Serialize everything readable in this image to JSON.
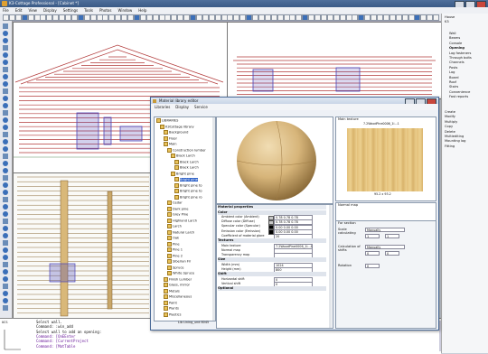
{
  "window": {
    "title": "K3-Cottage Professional - [Cabinet *]"
  },
  "menu": [
    "File",
    "Edit",
    "View",
    "Display",
    "Settings",
    "Tools",
    "Photos",
    "Window",
    "Help"
  ],
  "right_panel": {
    "top_items": [
      "House",
      "K3"
    ],
    "items": [
      {
        "label": "Wall"
      },
      {
        "label": "Beams"
      },
      {
        "label": "Console"
      },
      {
        "label": "Opening"
      },
      {
        "label": "Log fasteners"
      },
      {
        "label": "Through bolts"
      },
      {
        "label": "Channels"
      },
      {
        "label": "Posts"
      },
      {
        "label": "Log"
      },
      {
        "label": "Board"
      },
      {
        "label": "Roof"
      },
      {
        "label": "Stairs"
      },
      {
        "label": "Convenience"
      },
      {
        "label": "Fast reports"
      }
    ],
    "items2": [
      {
        "label": "Create"
      },
      {
        "label": "Modify"
      },
      {
        "label": "Multiply"
      },
      {
        "label": "Copy"
      },
      {
        "label": "Delete"
      },
      {
        "label": "Multiediting"
      },
      {
        "label": "Mounting log"
      },
      {
        "label": "Fitting"
      }
    ]
  },
  "command_area": {
    "side_label": "UCS",
    "lines": [
      "Select wall.",
      "Command: :win_add",
      "Select wall to add an opening:",
      "Command: [OnEEnter",
      "Command: [CurrentProject",
      "Command: [MatTable"
    ]
  },
  "dialog": {
    "title": "Material library editor",
    "menu": [
      "Libraries",
      "Display",
      "Service"
    ],
    "tree": [
      {
        "label": "LIBRARIES",
        "indent": 0
      },
      {
        "label": "K3Cottage library",
        "indent": 1
      },
      {
        "label": "Background",
        "indent": 2
      },
      {
        "label": "Floor",
        "indent": 2
      },
      {
        "label": "Main",
        "indent": 2
      },
      {
        "label": "Construction lumber",
        "indent": 3
      },
      {
        "label": "Black Larch",
        "indent": 4
      },
      {
        "label": "Black Larch",
        "indent": 5
      },
      {
        "label": "Black Larch",
        "indent": 5
      },
      {
        "label": "Bright pine",
        "indent": 4
      },
      {
        "label": "Bright pine",
        "indent": 5,
        "selected": true
      },
      {
        "label": "Bright pine to",
        "indent": 5
      },
      {
        "label": "Bright pine to",
        "indent": 5
      },
      {
        "label": "Bright pine ro",
        "indent": 5
      },
      {
        "label": "Cedar",
        "indent": 3
      },
      {
        "label": "Dark pine",
        "indent": 3
      },
      {
        "label": "Grey Pine",
        "indent": 3
      },
      {
        "label": "Highland Larch",
        "indent": 3
      },
      {
        "label": "Larch",
        "indent": 3
      },
      {
        "label": "Natural Larch",
        "indent": 3
      },
      {
        "label": "Oak",
        "indent": 3
      },
      {
        "label": "Pine",
        "indent": 3
      },
      {
        "label": "Pine 1",
        "indent": 3
      },
      {
        "label": "Pine 2",
        "indent": 3
      },
      {
        "label": "Siberian Fir",
        "indent": 3
      },
      {
        "label": "Spruce",
        "indent": 3
      },
      {
        "label": "White Spruce",
        "indent": 3
      },
      {
        "label": "Finish Lumber",
        "indent": 2
      },
      {
        "label": "Glass, mirror",
        "indent": 2
      },
      {
        "label": "Metals",
        "indent": 2
      },
      {
        "label": "Miscellaneous",
        "indent": 2
      },
      {
        "label": "Paint",
        "indent": 2
      },
      {
        "label": "Plants",
        "indent": 2
      },
      {
        "label": "Plastics",
        "indent": 2
      }
    ],
    "tree_status": "Lib Lining_und 8045",
    "props_header": "Material properties",
    "sections": [
      {
        "name": "Color",
        "rows": [
          {
            "k": "Ambient color (Ambient)",
            "v": "0.78 0.78 0.78",
            "sw": "#c7c7c7"
          },
          {
            "k": "Diffuse color (Diffuse)",
            "v": "0.78 0.78 0.78",
            "sw": "#c7c7c7"
          },
          {
            "k": "Specular color (Specular)",
            "v": "0.00 0.00 0.00",
            "sw": "#000000"
          },
          {
            "k": "Emission color (Emission)",
            "v": "0.00 0.00 0.00",
            "sw": "#000000"
          },
          {
            "k": "Coefficient of material glare",
            "v": "20"
          }
        ]
      },
      {
        "name": "Textures",
        "rows": [
          {
            "k": "Main texture",
            "v": "7.2WoodPine0006_1i...1"
          },
          {
            "k": "Normal map",
            "v": ""
          },
          {
            "k": "Transparency map",
            "v": ""
          }
        ]
      },
      {
        "name": "Size",
        "rows": [
          {
            "k": "Width (mm)",
            "v": "1024"
          },
          {
            "k": "Height (mm)",
            "v": "800"
          }
        ]
      },
      {
        "name": "Shift",
        "rows": [
          {
            "k": "Horizontal shift",
            "v": "0"
          },
          {
            "k": "Vertical shift",
            "v": "0"
          }
        ]
      },
      {
        "name": "Optional",
        "rows": []
      }
    ],
    "main_texture_label": "Main texture",
    "main_texture_name": "7.2WoodPine0006_1i...1",
    "texture_size": "95.2 x 93.2",
    "normal_map_label": "Normal map",
    "for_section": "For section",
    "scale_label": "Scale calculating",
    "scale_value": "Manually",
    "scale_x": "1",
    "scale_y": "1",
    "shifts_label": "Calculation of shifts",
    "shifts_value": "Manually",
    "shift_x": "0",
    "shift_y": "0",
    "rotation_label": "Rotation",
    "rotation_value": "0"
  },
  "colors": {
    "accent": "#2f62c8",
    "wall_red": "#b23a3a",
    "selection": "#4a44b8",
    "wood": "#d7b57a"
  }
}
